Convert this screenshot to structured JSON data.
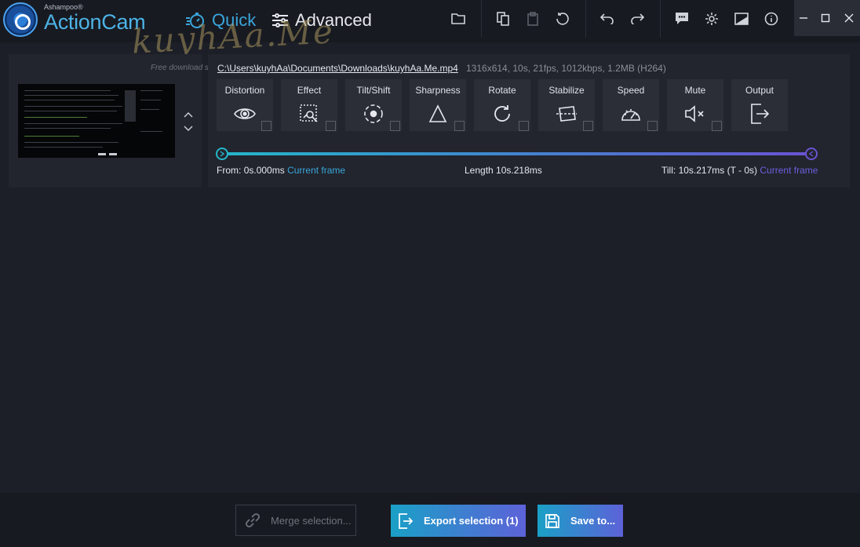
{
  "app": {
    "brand_small": "Ashampoo®",
    "brand": "ActionCam",
    "watermark": "kuyhAa.Me",
    "watermark_sub": "Free download soft"
  },
  "modes": {
    "quick": "Quick",
    "advanced": "Advanced"
  },
  "toolbar": {
    "icons": [
      "open-folder-icon",
      "copy-icon",
      "paste-icon",
      "reset-icon",
      "undo-icon",
      "redo-icon",
      "feedback-icon",
      "settings-icon",
      "stats-icon",
      "info-icon"
    ]
  },
  "window_controls": [
    "minimize-icon",
    "maximize-icon",
    "close-icon"
  ],
  "clip": {
    "path": "C:\\Users\\kuyhAa\\Documents\\Downloads\\kuyhAa.Me.mp4",
    "info": "1316x614, 10s, 21fps, 1012kbps, 1.2MB (H264)"
  },
  "tools": [
    {
      "label": "Distortion",
      "icon": "eye-icon"
    },
    {
      "label": "Effect",
      "icon": "effect-icon"
    },
    {
      "label": "Tilt/Shift",
      "icon": "tiltshift-icon"
    },
    {
      "label": "Sharpness",
      "icon": "triangle-icon"
    },
    {
      "label": "Rotate",
      "icon": "rotate-icon"
    },
    {
      "label": "Stabilize",
      "icon": "stabilize-icon"
    },
    {
      "label": "Speed",
      "icon": "speedometer-icon"
    },
    {
      "label": "Mute",
      "icon": "mute-icon"
    },
    {
      "label": "Output",
      "icon": "output-icon"
    }
  ],
  "timeline": {
    "from_label": "From:",
    "from_value": "0s.000ms",
    "from_link": "Current frame",
    "length_label": "Length",
    "length_value": "10s.218ms",
    "till_label": "Till:",
    "till_value": "10s.217ms (T - 0s)",
    "till_link": "Current frame",
    "colors": {
      "start": "#25b6c9",
      "end": "#6a53d2"
    }
  },
  "bottom": {
    "merge": "Merge selection...",
    "export": "Export selection (1)",
    "save": "Save to..."
  }
}
